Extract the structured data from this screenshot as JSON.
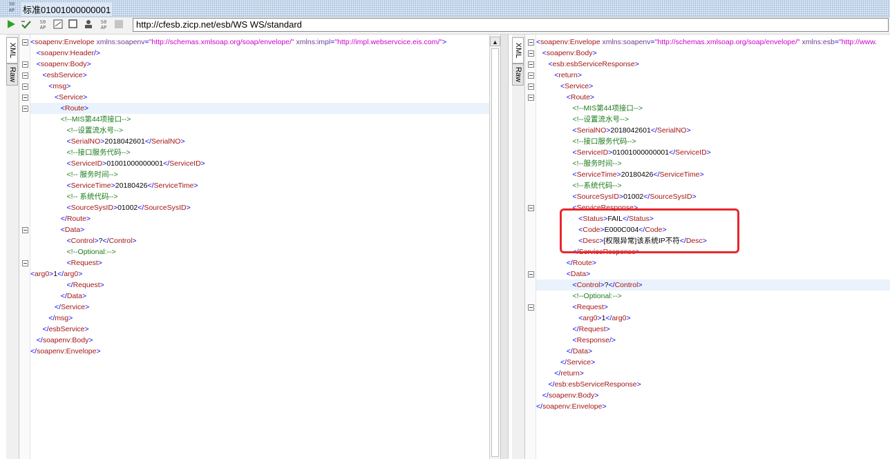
{
  "window": {
    "logo_top": "SO",
    "logo_bottom": "AP",
    "title": "标准01001000000001"
  },
  "toolbar": {
    "buttons": [
      "run-icon",
      "validate-icon",
      "soap-icon",
      "wsdl-icon",
      "stop-icon",
      "user-icon",
      "soap-config-icon",
      "gray-box-icon"
    ],
    "url": "http://cfesb.zicp.net/esb/WS WS/standard"
  },
  "tabs": {
    "xml": "XML",
    "raw": "Raw"
  },
  "request": {
    "lines": [
      [
        {
          "c": "b",
          "t": "<"
        },
        {
          "c": "t",
          "t": "soapenv:Envelope"
        },
        {
          "c": "a",
          "t": " xmlns:soapenv"
        },
        {
          "c": "b",
          "t": "="
        },
        {
          "c": "v",
          "t": "\"http://schemas.xmlsoap.org/soap/envelope/\""
        },
        {
          "c": "a",
          "t": " xmlns:impl"
        },
        {
          "c": "b",
          "t": "="
        },
        {
          "c": "v",
          "t": "\"http://impl.webservcice.eis.com/\""
        },
        {
          "c": "b",
          "t": ">"
        }
      ],
      [
        {
          "c": "b",
          "t": "   <"
        },
        {
          "c": "t",
          "t": "soapenv:Header"
        },
        {
          "c": "b",
          "t": "/>"
        }
      ],
      [
        {
          "c": "b",
          "t": "   <"
        },
        {
          "c": "t",
          "t": "soapenv:Body"
        },
        {
          "c": "b",
          "t": ">"
        }
      ],
      [
        {
          "c": "b",
          "t": "      <"
        },
        {
          "c": "t",
          "t": "esbService"
        },
        {
          "c": "b",
          "t": ">"
        }
      ],
      [
        {
          "c": "b",
          "t": "         <"
        },
        {
          "c": "t",
          "t": "msg"
        },
        {
          "c": "b",
          "t": ">"
        }
      ],
      [
        {
          "c": "b",
          "t": "            <"
        },
        {
          "c": "t",
          "t": "Service"
        },
        {
          "c": "b",
          "t": ">"
        }
      ],
      [
        {
          "c": "b",
          "t": "               <"
        },
        {
          "c": "t",
          "t": "Route"
        },
        {
          "c": "b",
          "t": ">"
        }
      ],
      [
        {
          "c": "c",
          "t": "               <!--MIS第44项接口-->"
        }
      ],
      [
        {
          "c": "c",
          "t": "                  <!--设置流水号-->"
        }
      ],
      [
        {
          "c": "b",
          "t": "                  <"
        },
        {
          "c": "t",
          "t": "SerialNO"
        },
        {
          "c": "b",
          "t": ">"
        },
        {
          "c": "x",
          "t": "2018042601"
        },
        {
          "c": "b",
          "t": "</"
        },
        {
          "c": "t",
          "t": "SerialNO"
        },
        {
          "c": "b",
          "t": ">"
        }
      ],
      [
        {
          "c": "c",
          "t": "                  <!--接口服务代码-->"
        }
      ],
      [
        {
          "c": "b",
          "t": "                  <"
        },
        {
          "c": "t",
          "t": "ServiceID"
        },
        {
          "c": "b",
          "t": ">"
        },
        {
          "c": "x",
          "t": "01001000000001"
        },
        {
          "c": "b",
          "t": "</"
        },
        {
          "c": "t",
          "t": "ServiceID"
        },
        {
          "c": "b",
          "t": ">"
        }
      ],
      [
        {
          "c": "c",
          "t": "                  <!-- 服务时间-->"
        }
      ],
      [
        {
          "c": "b",
          "t": "                  <"
        },
        {
          "c": "t",
          "t": "ServiceTime"
        },
        {
          "c": "b",
          "t": ">"
        },
        {
          "c": "x",
          "t": "20180426"
        },
        {
          "c": "b",
          "t": "</"
        },
        {
          "c": "t",
          "t": "ServiceTime"
        },
        {
          "c": "b",
          "t": ">"
        }
      ],
      [
        {
          "c": "c",
          "t": "                  <!-- 系统代码-->"
        }
      ],
      [
        {
          "c": "b",
          "t": "                  <"
        },
        {
          "c": "t",
          "t": "SourceSysID"
        },
        {
          "c": "b",
          "t": ">"
        },
        {
          "c": "x",
          "t": "01002"
        },
        {
          "c": "b",
          "t": "</"
        },
        {
          "c": "t",
          "t": "SourceSysID"
        },
        {
          "c": "b",
          "t": ">"
        }
      ],
      [
        {
          "c": "b",
          "t": "               </"
        },
        {
          "c": "t",
          "t": "Route"
        },
        {
          "c": "b",
          "t": ">"
        }
      ],
      [
        {
          "c": "b",
          "t": "               <"
        },
        {
          "c": "t",
          "t": "Data"
        },
        {
          "c": "b",
          "t": ">"
        }
      ],
      [
        {
          "c": "b",
          "t": "                  <"
        },
        {
          "c": "t",
          "t": "Control"
        },
        {
          "c": "b",
          "t": ">"
        },
        {
          "c": "x",
          "t": "?"
        },
        {
          "c": "b",
          "t": "</"
        },
        {
          "c": "t",
          "t": "Control"
        },
        {
          "c": "b",
          "t": ">"
        }
      ],
      [
        {
          "c": "c",
          "t": "                  <!--Optional:-->"
        }
      ],
      [
        {
          "c": "b",
          "t": "                  <"
        },
        {
          "c": "t",
          "t": "Request"
        },
        {
          "c": "b",
          "t": ">"
        }
      ],
      [
        {
          "c": "b",
          "t": "<"
        },
        {
          "c": "t",
          "t": "arg0"
        },
        {
          "c": "b",
          "t": ">"
        },
        {
          "c": "x",
          "t": "1"
        },
        {
          "c": "b",
          "t": "</"
        },
        {
          "c": "t",
          "t": "arg0"
        },
        {
          "c": "b",
          "t": ">"
        }
      ],
      [
        {
          "c": "b",
          "t": "                  </"
        },
        {
          "c": "t",
          "t": "Request"
        },
        {
          "c": "b",
          "t": ">"
        }
      ],
      [
        {
          "c": "b",
          "t": "               </"
        },
        {
          "c": "t",
          "t": "Data"
        },
        {
          "c": "b",
          "t": ">"
        }
      ],
      [
        {
          "c": "b",
          "t": "            </"
        },
        {
          "c": "t",
          "t": "Service"
        },
        {
          "c": "b",
          "t": ">"
        }
      ],
      [
        {
          "c": "b",
          "t": "         </"
        },
        {
          "c": "t",
          "t": "msg"
        },
        {
          "c": "b",
          "t": ">"
        }
      ],
      [
        {
          "c": "b",
          "t": "      </"
        },
        {
          "c": "t",
          "t": "esbService"
        },
        {
          "c": "b",
          "t": ">"
        }
      ],
      [
        {
          "c": "b",
          "t": "   </"
        },
        {
          "c": "t",
          "t": "soapenv:Body"
        },
        {
          "c": "b",
          "t": ">"
        }
      ],
      [
        {
          "c": "b",
          "t": "</"
        },
        {
          "c": "t",
          "t": "soapenv:Envelope"
        },
        {
          "c": "b",
          "t": ">"
        }
      ]
    ]
  },
  "response": {
    "lines": [
      [
        {
          "c": "b",
          "t": "<"
        },
        {
          "c": "t",
          "t": "soapenv:Envelope"
        },
        {
          "c": "a",
          "t": " xmlns:soapenv"
        },
        {
          "c": "b",
          "t": "="
        },
        {
          "c": "v",
          "t": "\"http://schemas.xmlsoap.org/soap/envelope/\""
        },
        {
          "c": "a",
          "t": " xmlns:esb"
        },
        {
          "c": "b",
          "t": "="
        },
        {
          "c": "v",
          "t": "\"http://www."
        }
      ],
      [
        {
          "c": "b",
          "t": "   <"
        },
        {
          "c": "t",
          "t": "soapenv:Body"
        },
        {
          "c": "b",
          "t": ">"
        }
      ],
      [
        {
          "c": "b",
          "t": "      <"
        },
        {
          "c": "t",
          "t": "esb:esbServiceResponse"
        },
        {
          "c": "b",
          "t": ">"
        }
      ],
      [
        {
          "c": "b",
          "t": "         <"
        },
        {
          "c": "t",
          "t": "return"
        },
        {
          "c": "b",
          "t": ">"
        }
      ],
      [
        {
          "c": "b",
          "t": "            <"
        },
        {
          "c": "t",
          "t": "Service"
        },
        {
          "c": "b",
          "t": ">"
        }
      ],
      [
        {
          "c": "b",
          "t": "               <"
        },
        {
          "c": "t",
          "t": "Route"
        },
        {
          "c": "b",
          "t": ">"
        }
      ],
      [
        {
          "c": "c",
          "t": "                  <!--MIS第44项接口-->"
        }
      ],
      [
        {
          "c": "c",
          "t": "                  <!--设置流水号-->"
        }
      ],
      [
        {
          "c": "b",
          "t": "                  <"
        },
        {
          "c": "t",
          "t": "SerialNO"
        },
        {
          "c": "b",
          "t": ">"
        },
        {
          "c": "x",
          "t": "2018042601"
        },
        {
          "c": "b",
          "t": "</"
        },
        {
          "c": "t",
          "t": "SerialNO"
        },
        {
          "c": "b",
          "t": ">"
        }
      ],
      [
        {
          "c": "c",
          "t": "                  <!--接口服务代码-->"
        }
      ],
      [
        {
          "c": "b",
          "t": "                  <"
        },
        {
          "c": "t",
          "t": "ServiceID"
        },
        {
          "c": "b",
          "t": ">"
        },
        {
          "c": "x",
          "t": "01001000000001"
        },
        {
          "c": "b",
          "t": "</"
        },
        {
          "c": "t",
          "t": "ServiceID"
        },
        {
          "c": "b",
          "t": ">"
        }
      ],
      [
        {
          "c": "c",
          "t": "                  <!--服务时间-->"
        }
      ],
      [
        {
          "c": "b",
          "t": "                  <"
        },
        {
          "c": "t",
          "t": "ServiceTime"
        },
        {
          "c": "b",
          "t": ">"
        },
        {
          "c": "x",
          "t": "20180426"
        },
        {
          "c": "b",
          "t": "</"
        },
        {
          "c": "t",
          "t": "ServiceTime"
        },
        {
          "c": "b",
          "t": ">"
        }
      ],
      [
        {
          "c": "c",
          "t": "                  <!--系统代码-->"
        }
      ],
      [
        {
          "c": "b",
          "t": "                  <"
        },
        {
          "c": "t",
          "t": "SourceSysID"
        },
        {
          "c": "b",
          "t": ">"
        },
        {
          "c": "x",
          "t": "01002"
        },
        {
          "c": "b",
          "t": "</"
        },
        {
          "c": "t",
          "t": "SourceSysID"
        },
        {
          "c": "b",
          "t": ">"
        }
      ],
      [
        {
          "c": "b",
          "t": "                  <"
        },
        {
          "c": "t",
          "t": "ServiceResponse"
        },
        {
          "c": "b",
          "t": ">"
        }
      ],
      [
        {
          "c": "b",
          "t": "                     <"
        },
        {
          "c": "t",
          "t": "Status"
        },
        {
          "c": "b",
          "t": ">"
        },
        {
          "c": "x",
          "t": "FAIL"
        },
        {
          "c": "b",
          "t": "</"
        },
        {
          "c": "t",
          "t": "Status"
        },
        {
          "c": "b",
          "t": ">"
        }
      ],
      [
        {
          "c": "b",
          "t": "                     <"
        },
        {
          "c": "t",
          "t": "Code"
        },
        {
          "c": "b",
          "t": ">"
        },
        {
          "c": "x",
          "t": "E000C004"
        },
        {
          "c": "b",
          "t": "</"
        },
        {
          "c": "t",
          "t": "Code"
        },
        {
          "c": "b",
          "t": ">"
        }
      ],
      [
        {
          "c": "b",
          "t": "                     <"
        },
        {
          "c": "t",
          "t": "Desc"
        },
        {
          "c": "b",
          "t": ">"
        },
        {
          "c": "x",
          "t": "[权限异常]该系统IP不符"
        },
        {
          "c": "b",
          "t": "</"
        },
        {
          "c": "t",
          "t": "Desc"
        },
        {
          "c": "b",
          "t": ">"
        }
      ],
      [
        {
          "c": "b",
          "t": "                  </"
        },
        {
          "c": "t",
          "t": "ServiceResponse"
        },
        {
          "c": "b",
          "t": ">"
        }
      ],
      [
        {
          "c": "b",
          "t": "               </"
        },
        {
          "c": "t",
          "t": "Route"
        },
        {
          "c": "b",
          "t": ">"
        }
      ],
      [
        {
          "c": "b",
          "t": "               <"
        },
        {
          "c": "t",
          "t": "Data"
        },
        {
          "c": "b",
          "t": ">"
        }
      ],
      [
        {
          "c": "b",
          "t": "                  <"
        },
        {
          "c": "t",
          "t": "Control"
        },
        {
          "c": "b",
          "t": ">"
        },
        {
          "c": "x",
          "t": "?"
        },
        {
          "c": "b",
          "t": "</"
        },
        {
          "c": "t",
          "t": "Control"
        },
        {
          "c": "b",
          "t": ">"
        }
      ],
      [
        {
          "c": "c",
          "t": "                  <!--Optional:-->"
        }
      ],
      [
        {
          "c": "b",
          "t": "                  <"
        },
        {
          "c": "t",
          "t": "Request"
        },
        {
          "c": "b",
          "t": ">"
        }
      ],
      [
        {
          "c": "b",
          "t": "                     <"
        },
        {
          "c": "t",
          "t": "arg0"
        },
        {
          "c": "b",
          "t": ">"
        },
        {
          "c": "x",
          "t": "1"
        },
        {
          "c": "b",
          "t": "</"
        },
        {
          "c": "t",
          "t": "arg0"
        },
        {
          "c": "b",
          "t": ">"
        }
      ],
      [
        {
          "c": "b",
          "t": "                  </"
        },
        {
          "c": "t",
          "t": "Request"
        },
        {
          "c": "b",
          "t": ">"
        }
      ],
      [
        {
          "c": "b",
          "t": "                  <"
        },
        {
          "c": "t",
          "t": "Response"
        },
        {
          "c": "b",
          "t": "/>"
        }
      ],
      [
        {
          "c": "b",
          "t": "               </"
        },
        {
          "c": "t",
          "t": "Data"
        },
        {
          "c": "b",
          "t": ">"
        }
      ],
      [
        {
          "c": "b",
          "t": "            </"
        },
        {
          "c": "t",
          "t": "Service"
        },
        {
          "c": "b",
          "t": ">"
        }
      ],
      [
        {
          "c": "b",
          "t": "         </"
        },
        {
          "c": "t",
          "t": "return"
        },
        {
          "c": "b",
          "t": ">"
        }
      ],
      [
        {
          "c": "b",
          "t": "      </"
        },
        {
          "c": "t",
          "t": "esb:esbServiceResponse"
        },
        {
          "c": "b",
          "t": ">"
        }
      ],
      [
        {
          "c": "b",
          "t": "   </"
        },
        {
          "c": "t",
          "t": "soapenv:Body"
        },
        {
          "c": "b",
          "t": ">"
        }
      ],
      [
        {
          "c": "b",
          "t": "</"
        },
        {
          "c": "t",
          "t": "soapenv:Envelope"
        },
        {
          "c": "b",
          "t": ">"
        }
      ]
    ]
  }
}
